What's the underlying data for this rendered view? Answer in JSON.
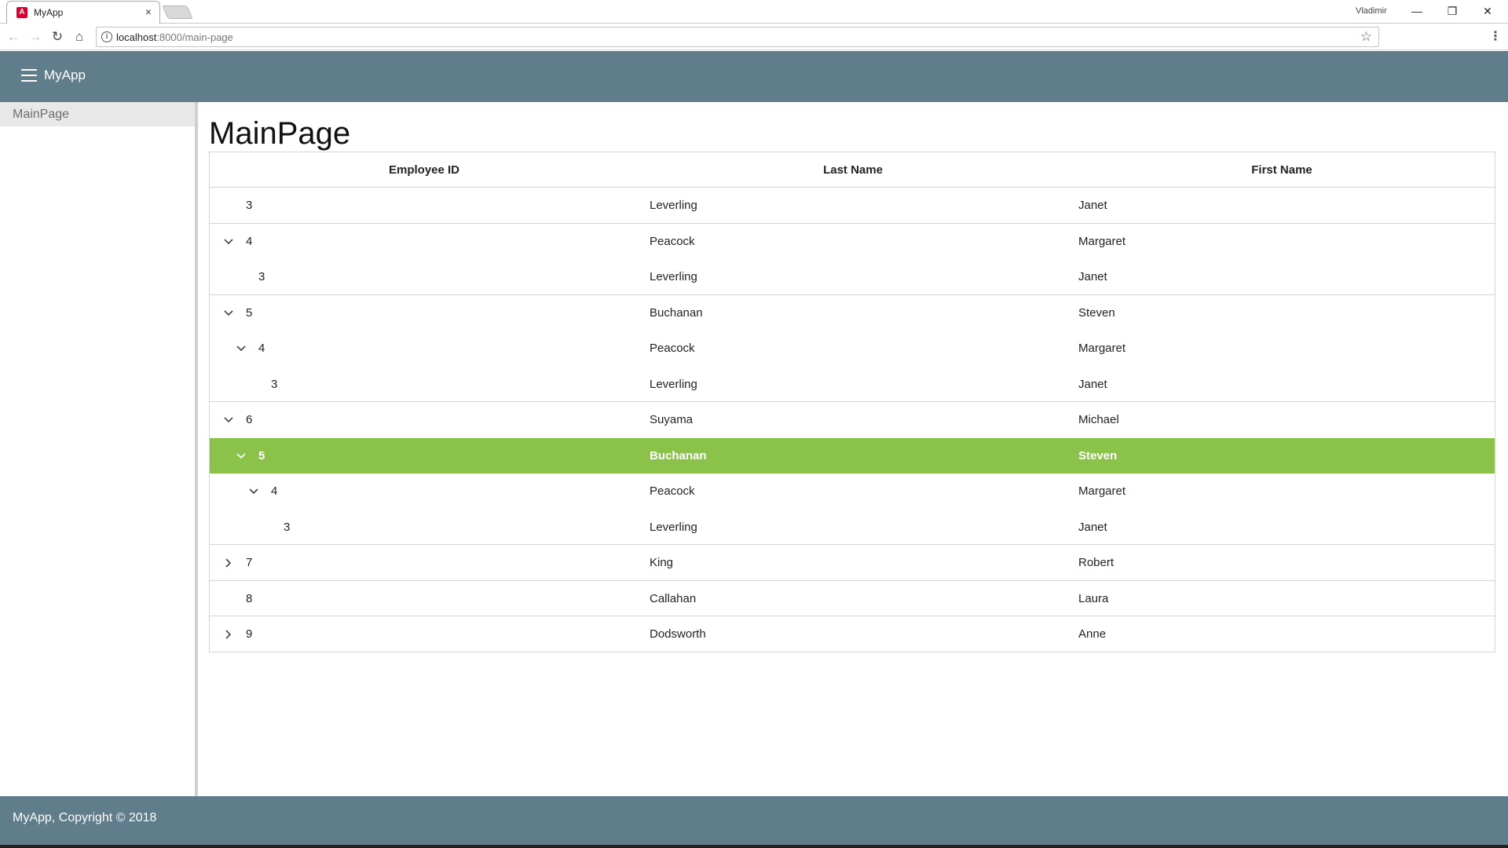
{
  "browser": {
    "tab_title": "MyApp",
    "tab_close": "×",
    "profile_name": "Vladimir",
    "url_host": "localhost",
    "url_path": ":8000/main-page"
  },
  "app": {
    "title": "MyApp",
    "header_color": "#607d8b"
  },
  "sidebar": {
    "items": [
      {
        "label": "MainPage"
      }
    ]
  },
  "main": {
    "page_title": "MainPage",
    "grid": {
      "columns": [
        "Employee ID",
        "Last Name",
        "First Name"
      ],
      "selected_color": "#8bc34a",
      "rows": [
        {
          "id": "3",
          "last": "Leverling",
          "first": "Janet",
          "level": 0,
          "toggle": "none",
          "selected": false,
          "group_end": true
        },
        {
          "id": "4",
          "last": "Peacock",
          "first": "Margaret",
          "level": 0,
          "toggle": "expanded",
          "selected": false,
          "group_end": false
        },
        {
          "id": "3",
          "last": "Leverling",
          "first": "Janet",
          "level": 1,
          "toggle": "none",
          "selected": false,
          "group_end": true
        },
        {
          "id": "5",
          "last": "Buchanan",
          "first": "Steven",
          "level": 0,
          "toggle": "expanded",
          "selected": false,
          "group_end": false
        },
        {
          "id": "4",
          "last": "Peacock",
          "first": "Margaret",
          "level": 1,
          "toggle": "expanded",
          "selected": false,
          "group_end": false
        },
        {
          "id": "3",
          "last": "Leverling",
          "first": "Janet",
          "level": 2,
          "toggle": "none",
          "selected": false,
          "group_end": true
        },
        {
          "id": "6",
          "last": "Suyama",
          "first": "Michael",
          "level": 0,
          "toggle": "expanded",
          "selected": false,
          "group_end": false
        },
        {
          "id": "5",
          "last": "Buchanan",
          "first": "Steven",
          "level": 1,
          "toggle": "expanded",
          "selected": true,
          "group_end": false
        },
        {
          "id": "4",
          "last": "Peacock",
          "first": "Margaret",
          "level": 2,
          "toggle": "expanded",
          "selected": false,
          "group_end": false
        },
        {
          "id": "3",
          "last": "Leverling",
          "first": "Janet",
          "level": 3,
          "toggle": "none",
          "selected": false,
          "group_end": true
        },
        {
          "id": "7",
          "last": "King",
          "first": "Robert",
          "level": 0,
          "toggle": "collapsed",
          "selected": false,
          "group_end": true
        },
        {
          "id": "8",
          "last": "Callahan",
          "first": "Laura",
          "level": 0,
          "toggle": "none",
          "selected": false,
          "group_end": true
        },
        {
          "id": "9",
          "last": "Dodsworth",
          "first": "Anne",
          "level": 0,
          "toggle": "collapsed",
          "selected": false,
          "group_end": false
        }
      ]
    }
  },
  "footer": {
    "text": "MyApp, Copyright © 2018"
  }
}
